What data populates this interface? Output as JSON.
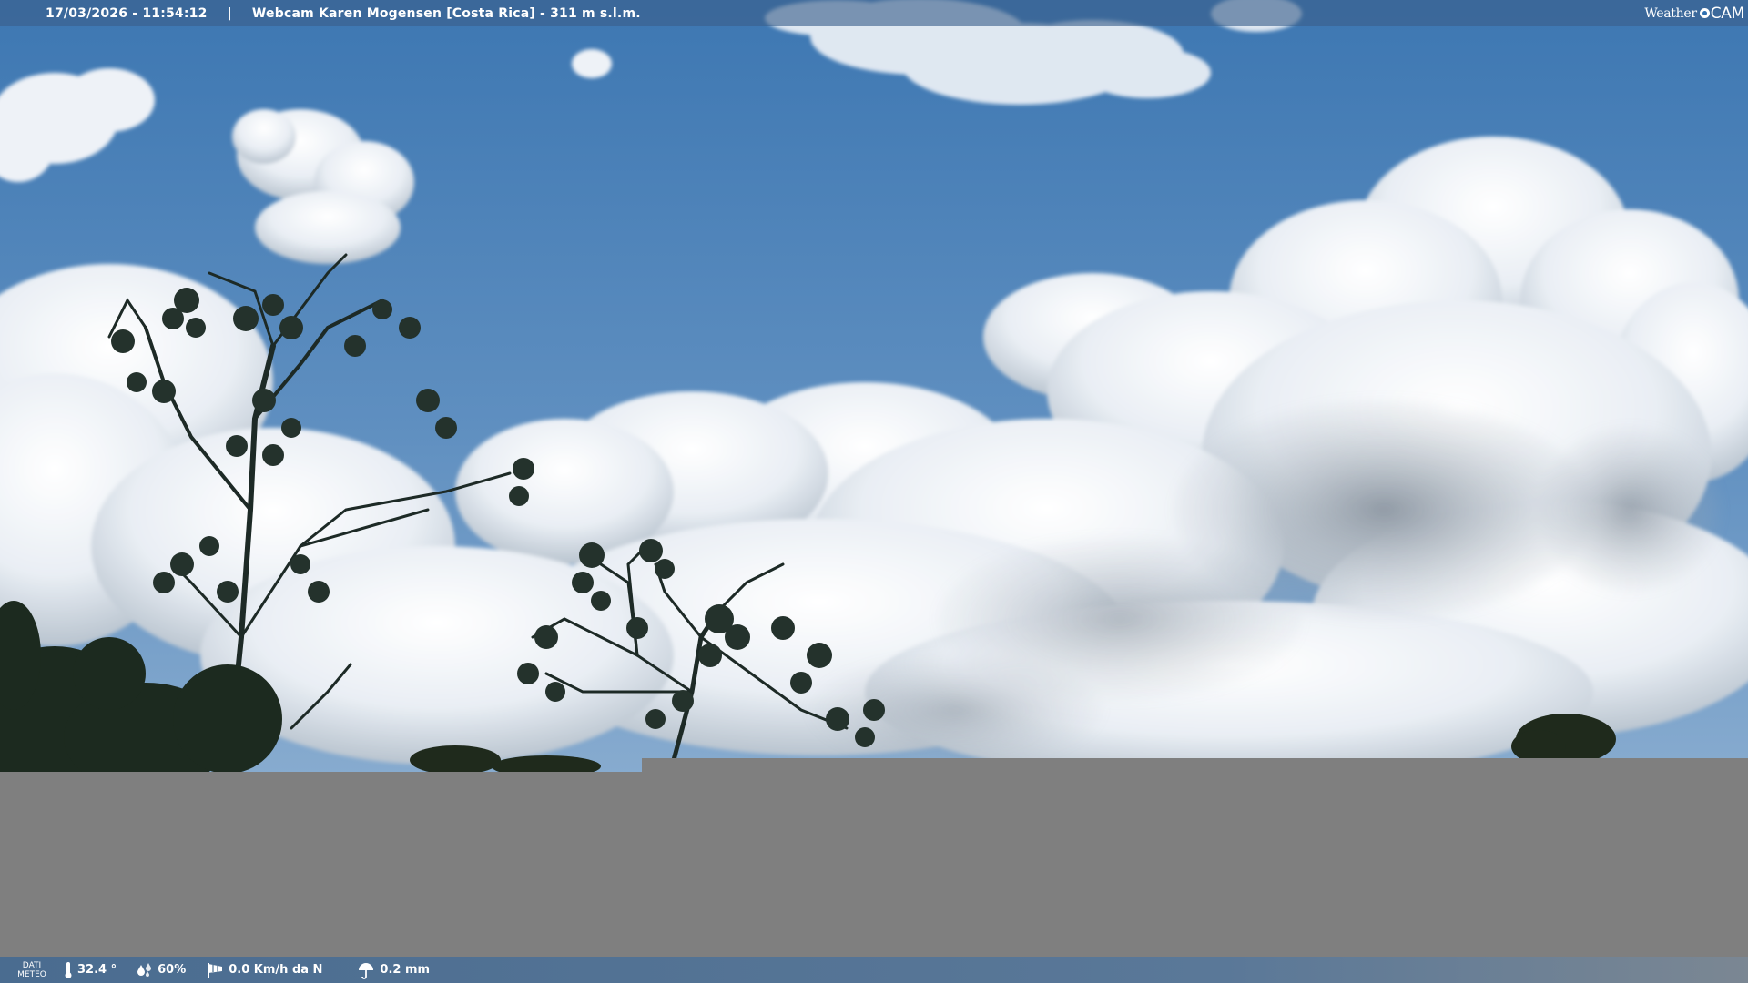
{
  "header": {
    "datetime": "17/03/2026 - 11:54:12",
    "separator": "|",
    "webcam_title": "Webcam Karen Mogensen [Costa Rica]  - 311 m s.l.m."
  },
  "brand": {
    "part1": "Weather",
    "part2": "CAM"
  },
  "footer": {
    "meteo_label_line1": "DATI",
    "meteo_label_line2": "METEO",
    "temperature": "32.4 °",
    "humidity": "60%",
    "wind": "0.0 Km/h da N",
    "rain": "0.2 mm"
  },
  "icons": {
    "temperature": "thermometer-icon",
    "humidity": "droplets-icon",
    "wind": "windsock-icon",
    "rain": "umbrella-icon"
  },
  "colors": {
    "sky_top": "#3f79b4",
    "sky_bottom": "#6d9ac6",
    "gray_fill": "#7f7f7f",
    "bar": "#3a608a"
  }
}
